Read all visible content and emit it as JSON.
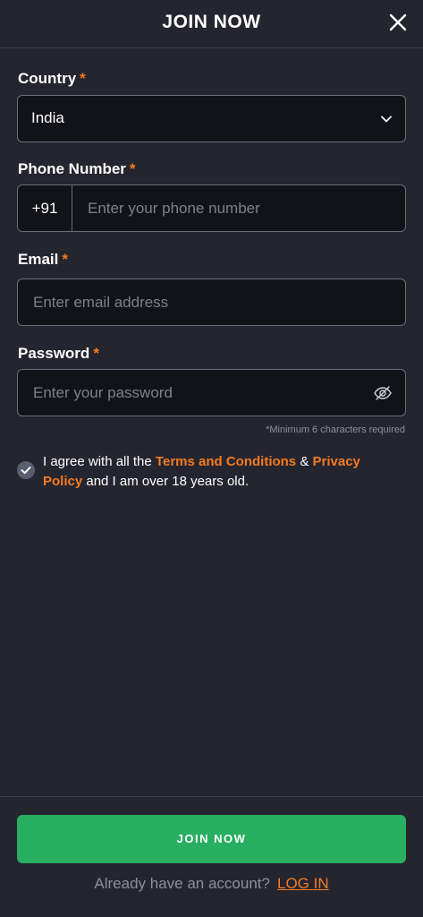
{
  "header": {
    "title": "JOIN NOW"
  },
  "form": {
    "country": {
      "label": "Country",
      "required_mark": "*",
      "value": "India"
    },
    "phone": {
      "label": "Phone Number",
      "required_mark": "*",
      "prefix": "+91",
      "placeholder": "Enter your phone number"
    },
    "email": {
      "label": "Email",
      "required_mark": "*",
      "placeholder": "Enter email address"
    },
    "password": {
      "label": "Password",
      "required_mark": "*",
      "placeholder": "Enter your password",
      "hint": "*Minimum 6 characters required"
    },
    "agreement": {
      "checked": true,
      "text_before": "I agree with all the",
      "terms_link": "Terms and Conditions",
      "ampersand": "&",
      "privacy_link": "Privacy Policy",
      "text_after": "and I am over 18 years old."
    }
  },
  "footer": {
    "join_label": "JOIN NOW",
    "login_prompt": "Already have an account?",
    "login_link": "LOG IN"
  },
  "colors": {
    "background": "#25252f",
    "field_bg": "#121318",
    "accent_orange": "#f47b20",
    "primary_green": "#27ae60"
  },
  "icons": {
    "close": "close-icon",
    "dropdown": "chevron-down-icon",
    "password_toggle": "eye-off-icon",
    "checkbox": "checkmark-icon"
  }
}
